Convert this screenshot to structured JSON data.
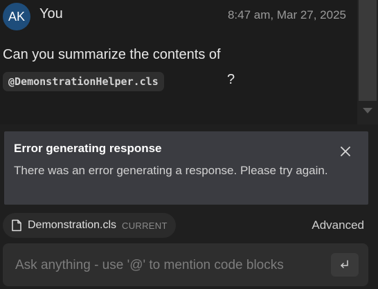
{
  "message": {
    "avatar_initials": "AK",
    "author": "You",
    "timestamp": "8:47 am, Mar 27, 2025",
    "text": "Can you summarize the contents of",
    "mention": "@DemonstrationHelper.cls",
    "suffix": "?"
  },
  "error": {
    "title": "Error generating response",
    "message": "There was an error generating a response. Please try again."
  },
  "context": {
    "file_name": "Demonstration.cls",
    "file_tag": "CURRENT",
    "advanced_label": "Advanced"
  },
  "input": {
    "placeholder": "Ask anything - use '@' to mention code blocks"
  },
  "colors": {
    "avatar_bg": "#1e4d7b",
    "error_bg": "#3b3c41"
  },
  "icons": {
    "close": "close-icon",
    "file": "file-icon",
    "send": "enter-icon"
  }
}
